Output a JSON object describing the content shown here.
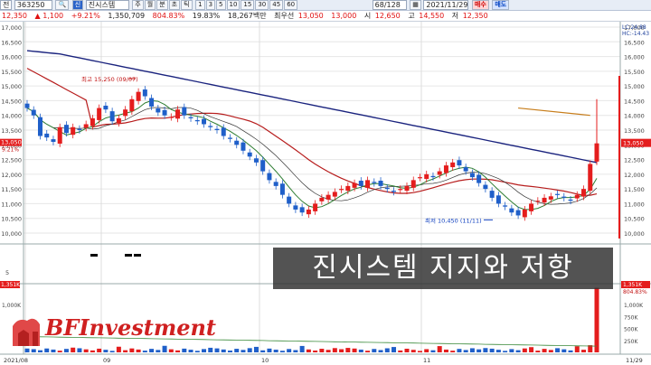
{
  "toolbar": {
    "selector": "전",
    "code": "363250",
    "search_icon": "magnifier-icon",
    "name_badge": "신",
    "stock_name": "진시스템",
    "periods": [
      "주",
      "월",
      "분",
      "초",
      "틱"
    ],
    "intervals": [
      "1",
      "3",
      "5",
      "10",
      "15",
      "30",
      "45",
      "60"
    ],
    "count": "68/128",
    "date": "2021/11/29",
    "sell_label": "매수",
    "buy_label": "매도"
  },
  "infobar": {
    "price": "12,350",
    "change": "▲ 1,100",
    "change_pct": "+9.21%",
    "volume": "1,350,709",
    "volume_ratio": "804.83%",
    "turnover": "19.83%",
    "amount": "18,267백만",
    "best_sell_label": "최우선",
    "best_sell": "13,050",
    "best_buy": "13,000",
    "open_label": "시",
    "open": "12,650",
    "high_label": "고",
    "high": "14,550",
    "low_label": "저",
    "low": "12,350"
  },
  "axis": {
    "y_ticks": [
      "17,000",
      "16,500",
      "16,000",
      "15,500",
      "15,000",
      "14,500",
      "14,000",
      "13,500",
      "13,000",
      "12,500",
      "12,000",
      "11,500",
      "11,000",
      "10,500",
      "10,000"
    ],
    "x_ticks": [
      "2021/08",
      "09",
      "10",
      "11",
      "11/29"
    ],
    "hl_labels": [
      "LC:24.88",
      "HC:-14.43"
    ],
    "current_price_tag": "13,050",
    "current_pct_tag": "9.21%",
    "mid_tick": "5",
    "vol_ticks": [
      "1,000K",
      "750K",
      "500K",
      "250K"
    ],
    "vol_tag": "1,351K",
    "vol_pct_tag": "804.83%",
    "vol_left_tag": "1,351K",
    "vol_left_tick": "1,000K"
  },
  "annotations": {
    "high": "최고 15,250 (09/07)",
    "low": "최저 10,450 (11/11)"
  },
  "caption": "진시스템 지지와 저항",
  "watermark": {
    "text": "BFInvestment"
  },
  "colors": {
    "up": "#e41d1d",
    "down": "#1f5fc9",
    "ma_long": "#1a237e",
    "ma_mid": "#b71c1c",
    "ma_short": "#2e7d32",
    "ma_5": "#333333",
    "pending": "#c77d1a"
  }
}
